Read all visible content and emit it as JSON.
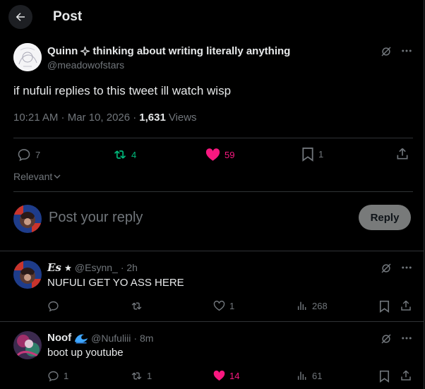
{
  "header": {
    "title": "Post"
  },
  "post": {
    "author_name": "Quinn",
    "author_tail": "thinking about writing literally anything",
    "handle": "@meadowofstars",
    "text": "if nufuli replies to this tweet ill watch wisp",
    "time": "10:21 AM · Mar 10, 2026 ·",
    "views_count": "1,631",
    "views_label": "Views",
    "stats": {
      "replies": "7",
      "reposts": "4",
      "likes": "59",
      "bookmarks": "1"
    }
  },
  "sort": {
    "label": "Relevant"
  },
  "composer": {
    "placeholder": "Post your reply",
    "button": "Reply"
  },
  "replies": [
    {
      "name": "Es",
      "handle": "@Esynn_",
      "time": "· 2h",
      "text": "NUFULI GET YO ASS HERE",
      "replies": "",
      "reposts": "",
      "likes": "1",
      "views": "268"
    },
    {
      "name": "Noof",
      "handle": "@Nufuliii",
      "time": "· 8m",
      "text": "boot up youtube",
      "replies": "1",
      "reposts": "1",
      "likes": "14",
      "views": "61"
    }
  ],
  "colors": {
    "accent_like": "#f91880",
    "repost": "#00ba7c",
    "muted": "#71767b",
    "text": "#e7e9ea"
  },
  "icons": [
    "back-arrow-icon",
    "grok-icon",
    "more-icon",
    "reply-icon",
    "repost-icon",
    "like-icon",
    "bookmark-icon",
    "share-icon",
    "views-icon",
    "chevron-down-icon",
    "sparkle-icon",
    "star-icon",
    "wave-icon"
  ]
}
